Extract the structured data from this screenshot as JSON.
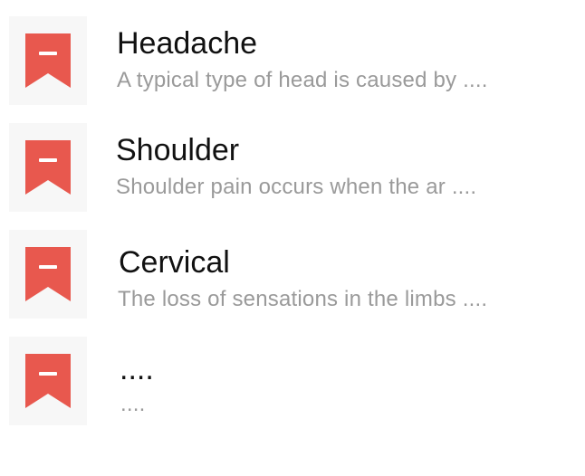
{
  "colors": {
    "accent": "#E8584E",
    "icon_bg": "#F7F7F7",
    "title": "#111111",
    "description": "#9A9A9A"
  },
  "items": [
    {
      "icon": "bookmark-minus-icon",
      "title": "Headache",
      "description": "A typical type of head is caused by ...."
    },
    {
      "icon": "bookmark-minus-icon",
      "title": "Shoulder",
      "description": "Shoulder pain occurs when the ar  ...."
    },
    {
      "icon": "bookmark-minus-icon",
      "title": "Cervical",
      "description": "The loss of sensations in the limbs  ...."
    },
    {
      "icon": "bookmark-minus-icon",
      "title": "....",
      "description": "...."
    }
  ]
}
